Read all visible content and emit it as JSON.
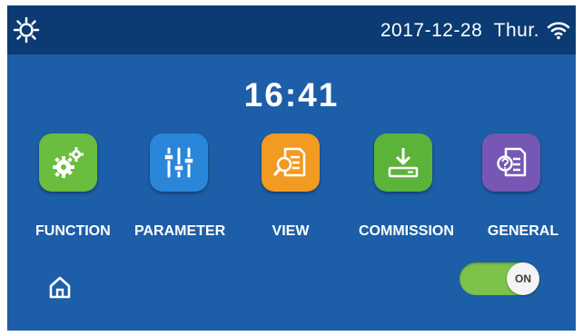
{
  "header": {
    "date": "2017-12-28",
    "weekday": "Thur."
  },
  "clock": {
    "time": "16:41"
  },
  "menu": [
    {
      "label": "FUNCTION",
      "color": "#6bbd3f",
      "icon": "gears-icon"
    },
    {
      "label": "PARAMETER",
      "color": "#2a86d8",
      "icon": "sliders-icon"
    },
    {
      "label": "VIEW",
      "color": "#f39a22",
      "icon": "document-search-icon"
    },
    {
      "label": "COMMISSION",
      "color": "#5cb33a",
      "icon": "download-icon"
    },
    {
      "label": "GENERAL",
      "color": "#7657b3",
      "icon": "question-document-icon"
    }
  ],
  "toggle": {
    "label": "ON",
    "state": "on"
  },
  "colors": {
    "background": "#1d5ea8",
    "topbar": "#0c3a73",
    "toggle_track": "#7dc24a"
  }
}
